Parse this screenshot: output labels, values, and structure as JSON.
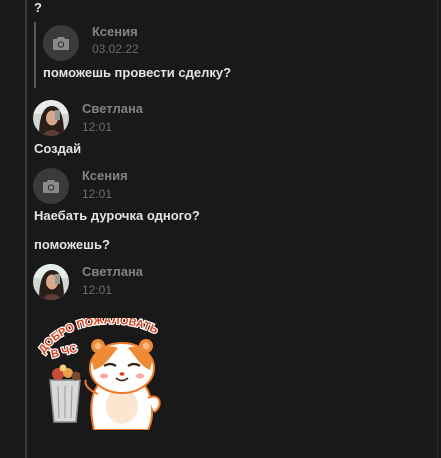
{
  "messages": {
    "top_fragment": "?",
    "quote": {
      "author": "Ксения",
      "date": "03.02.22",
      "text": "поможешь провести сделку?"
    },
    "m1": {
      "author": "Светлана",
      "time": "12:01",
      "text": "Создай"
    },
    "m2": {
      "author": "Ксения",
      "time": "12:01",
      "text1": "Наебать дурочка одного?",
      "text2": "поможешь?"
    },
    "m3": {
      "author": "Светлана",
      "time": "12:01"
    }
  },
  "sticker": {
    "line1": "ДОБРО ПОЖАЛОВАТЬ",
    "line2": "В ЧС"
  }
}
